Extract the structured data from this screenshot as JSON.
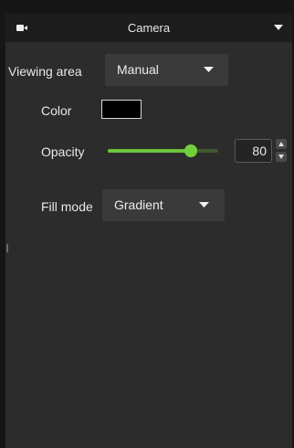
{
  "header": {
    "title": "Camera",
    "icon": "camera-icon",
    "menu_icon": "chevron-down-icon"
  },
  "viewing_area": {
    "label": "Viewing area",
    "value": "Manual"
  },
  "color": {
    "label": "Color",
    "value": "#000000"
  },
  "opacity": {
    "label": "Opacity",
    "value": "80",
    "fraction": 0.75
  },
  "fill_mode": {
    "label": "Fill mode",
    "value": "Gradient"
  },
  "colors": {
    "accent": "#6cc43a",
    "panel": "#2c2c2c",
    "header": "#1d1d1d"
  }
}
